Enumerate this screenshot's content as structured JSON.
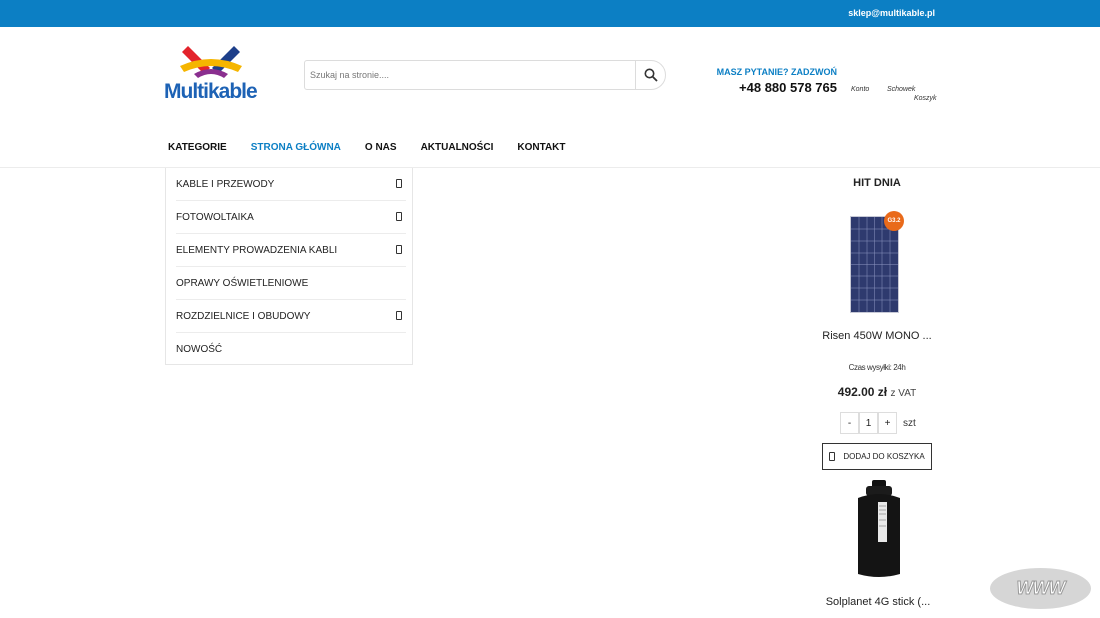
{
  "topbar": {
    "email": "sklep@multikable.pl"
  },
  "logo": {
    "text_main": "Multi",
    "text_rest": "kable"
  },
  "search": {
    "placeholder": "Szukaj na stronie...."
  },
  "contact": {
    "ask": "MASZ PYTANIE? ZADZWOŃ",
    "phone": "+48 880 578 765"
  },
  "account": {
    "konto": "Konto",
    "schowek": "Schowek",
    "koszyk": "Koszyk"
  },
  "nav": {
    "items": [
      {
        "label": "KATEGORIE",
        "active": false
      },
      {
        "label": "STRONA GŁÓWNA",
        "active": true
      },
      {
        "label": "O NAS",
        "active": false
      },
      {
        "label": "AKTUALNOŚCI",
        "active": false
      },
      {
        "label": "KONTAKT",
        "active": false
      }
    ]
  },
  "categories": [
    {
      "label": "KABLE I PRZEWODY",
      "has_sub": true
    },
    {
      "label": "FOTOWOLTAIKA",
      "has_sub": true
    },
    {
      "label": "ELEMENTY PROWADZENIA KABLI",
      "has_sub": true
    },
    {
      "label": "OPRAWY OŚWIETLENIOWE",
      "has_sub": false
    },
    {
      "label": "ROZDZIELNICE I OBUDOWY",
      "has_sub": true
    },
    {
      "label": "NOWOŚĆ",
      "has_sub": false
    }
  ],
  "hit": {
    "title": "HIT DNIA",
    "badge": "G3.2",
    "product_name": "Risen 450W MONO ...",
    "shipping": "Czas wysyłki: 24h",
    "price": "492.00 zł",
    "vat": "z VAT",
    "qty_minus": "-",
    "qty_value": "1",
    "qty_plus": "+",
    "unit": "szt",
    "add_to_cart": "DODAJ DO KOSZYKA",
    "product2_name": "Solplanet 4G stick (..."
  },
  "badge_www": "WWW",
  "colors": {
    "brand_blue": "#0c7fc4",
    "logo_red": "#e3232b",
    "logo_yellow": "#f5b500",
    "logo_navy": "#1d3f8a"
  }
}
